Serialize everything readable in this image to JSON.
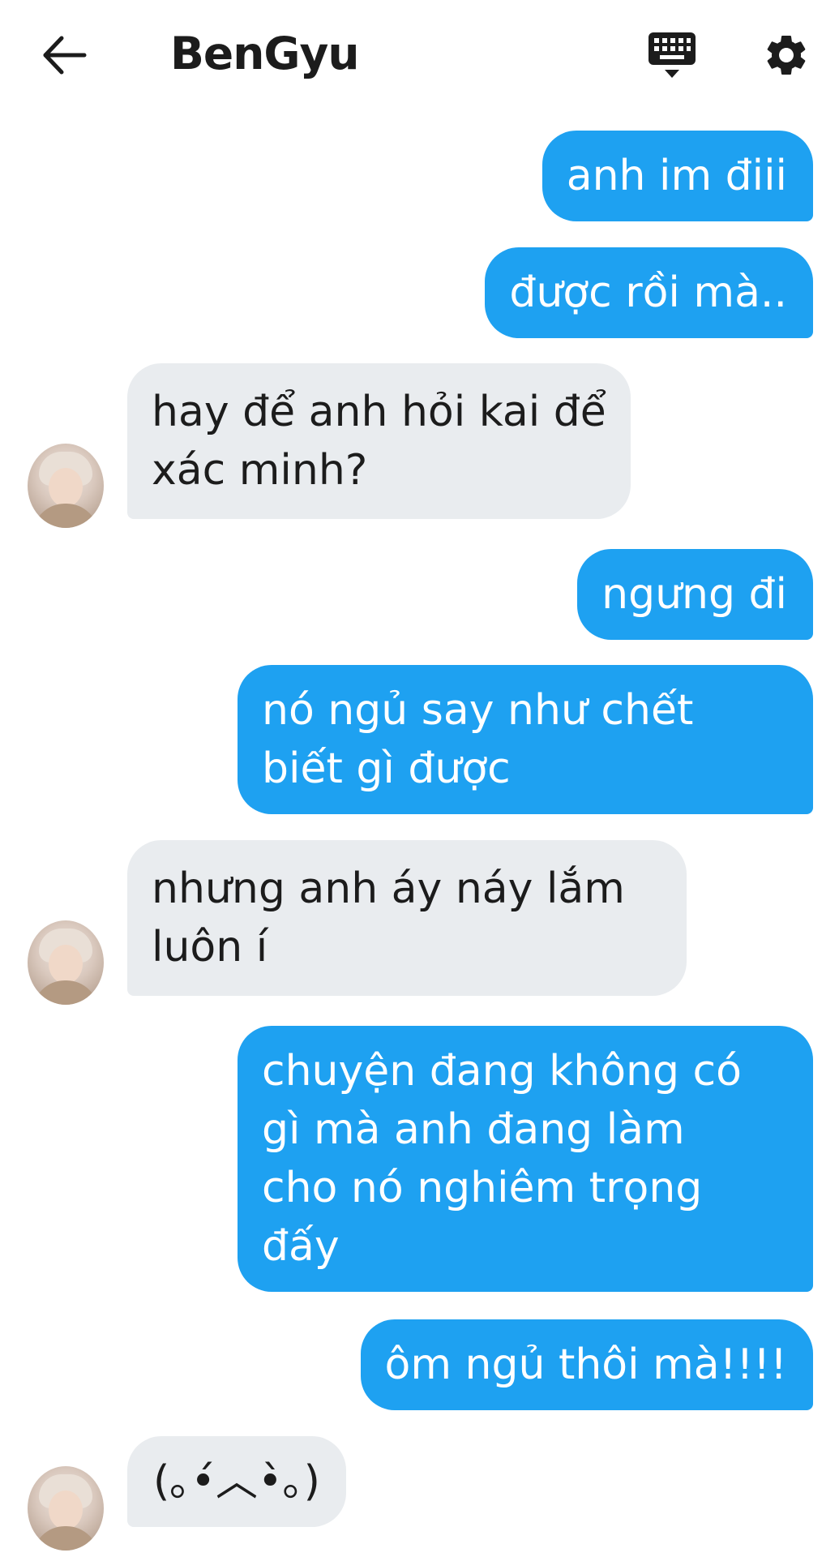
{
  "header": {
    "back_icon": "arrow-left-icon",
    "title": "BenGyu",
    "keyboard_icon": "keyboard-icon",
    "settings_icon": "gear-icon"
  },
  "colors": {
    "sent_bubble": "#1ea1f1",
    "received_bubble": "#e9ecef",
    "text_dark": "#1c1c1c"
  },
  "messages": [
    {
      "sender": "me",
      "text": "anh im điii"
    },
    {
      "sender": "me",
      "text": "được rồi mà.."
    },
    {
      "sender": "other",
      "text": "hay để anh hỏi kai để\nxác minh?"
    },
    {
      "sender": "me",
      "text": "ngưng đi"
    },
    {
      "sender": "me",
      "text": "nó ngủ say như chết\nbiết gì được"
    },
    {
      "sender": "other",
      "text": "nhưng anh áy náy lắm\nluôn í"
    },
    {
      "sender": "me",
      "text": "chuyện đang không có\ngì mà anh đang làm\ncho nó nghiêm trọng\nđấy"
    },
    {
      "sender": "me",
      "text": "ôm ngủ thôi mà!!!!"
    },
    {
      "sender": "other",
      "text": "(｡•́︿•̀｡)"
    }
  ]
}
